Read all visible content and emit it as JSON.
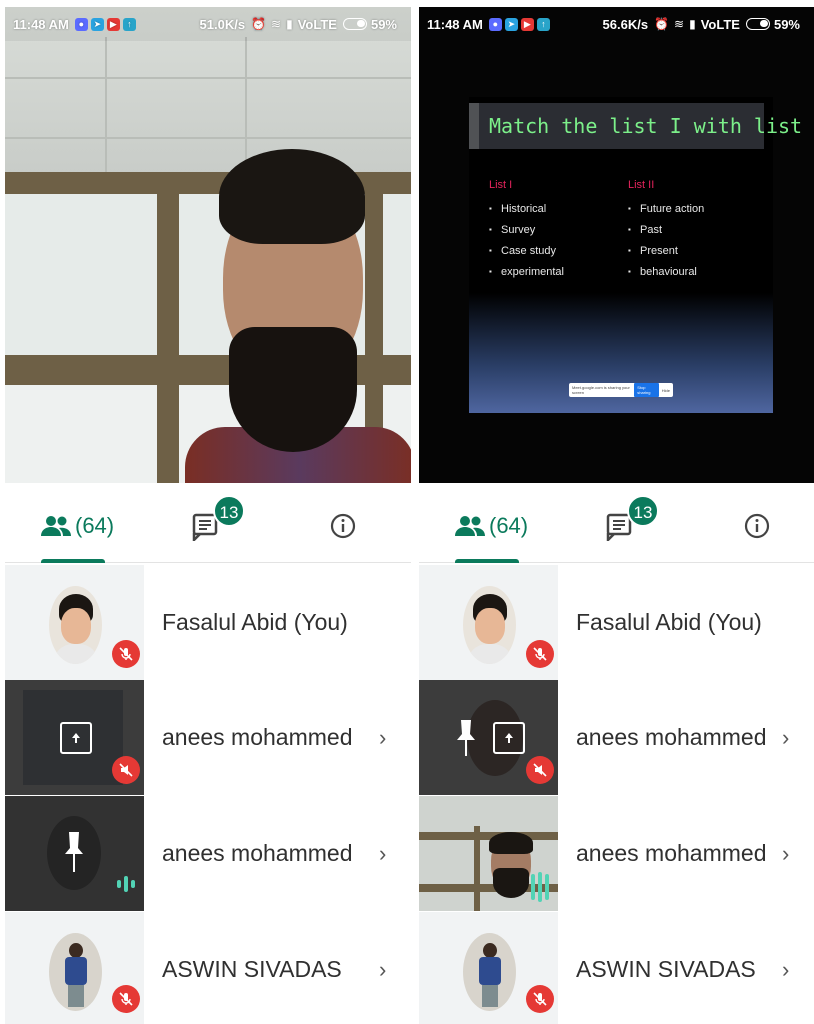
{
  "left_panel": {
    "status": {
      "time": "11:48 AM",
      "speed": "51.0K/s",
      "network": "VoLTE",
      "battery": "59%"
    },
    "tabs": {
      "people_count": "(64)",
      "chat_badge": "13"
    },
    "participants": [
      {
        "name": "Fasalul Abid (You)",
        "muted": true
      },
      {
        "name": "anees mohammed",
        "muted": true,
        "presenting": true
      },
      {
        "name": "anees mohammed",
        "speaking": true
      },
      {
        "name": "ASWIN SIVADAS",
        "muted": true
      }
    ]
  },
  "right_panel": {
    "status": {
      "time": "11:48 AM",
      "speed": "56.6K/s",
      "network": "VoLTE",
      "battery": "59%"
    },
    "slide": {
      "title": "Match the list I with list II",
      "list1_header": "List I",
      "list1": [
        "Historical",
        "Survey",
        "Case study",
        "experimental"
      ],
      "list2_header": "List II",
      "list2": [
        "Future action",
        "Past",
        "Present",
        "behavioural"
      ],
      "bar_text": "Meet.google.com is sharing your screen",
      "bar_button": "Stop sharing",
      "bar_hide": "Hide"
    },
    "tabs": {
      "people_count": "(64)",
      "chat_badge": "13"
    },
    "participants": [
      {
        "name": "Fasalul Abid (You)",
        "muted": true
      },
      {
        "name": "anees mohammed",
        "muted": true,
        "presenting": true
      },
      {
        "name": "anees mohammed",
        "speaking": true
      },
      {
        "name": "ASWIN SIVADAS",
        "muted": true
      }
    ]
  },
  "colors": {
    "accent": "#0b7a5c",
    "muted_red": "#e53935",
    "speaking": "#52d3b5"
  },
  "icons": [
    "people-icon",
    "chat-icon",
    "info-icon",
    "mic-off-icon",
    "present-icon",
    "chevron-right-icon",
    "speaking-icon",
    "pin-icon"
  ]
}
